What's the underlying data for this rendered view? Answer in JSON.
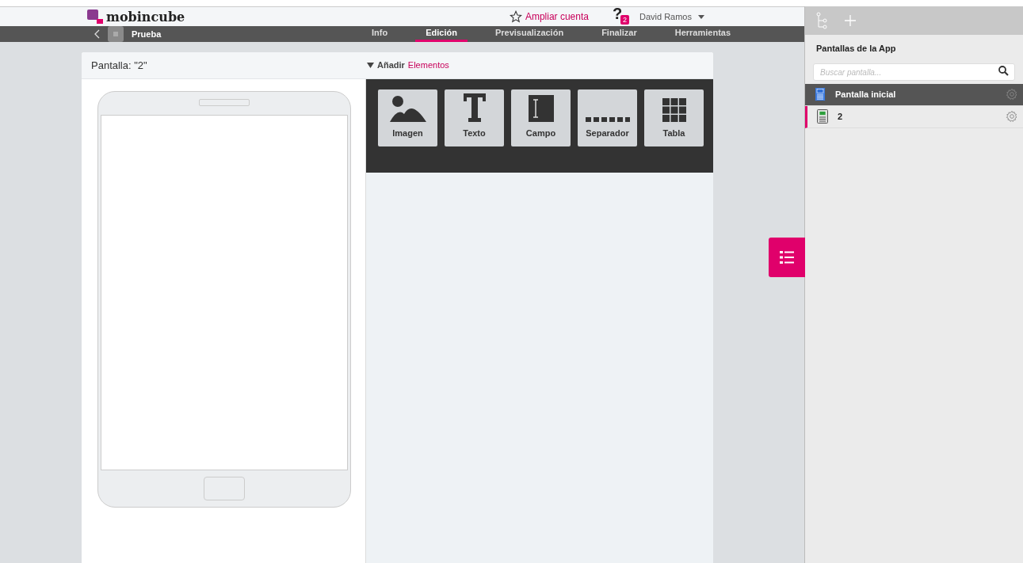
{
  "header": {
    "logo": "mobincube",
    "upgrade_link": "Ampliar cuenta",
    "help_icon": "?",
    "help_badge": "2",
    "user": "David Ramos"
  },
  "nav": {
    "project": "Prueba",
    "tabs": [
      {
        "label": "Info",
        "selected": false
      },
      {
        "label": "Edición",
        "selected": true
      },
      {
        "label": "Previsualización",
        "selected": false
      },
      {
        "label": "Finalizar",
        "selected": false
      },
      {
        "label": "Herramientas",
        "selected": false
      }
    ]
  },
  "editor": {
    "screen_title": "Pantalla: \"2\"",
    "add_toggle": "Añadir",
    "add_link": "Elementos",
    "elements": [
      {
        "kind": "image",
        "label": "Imagen"
      },
      {
        "kind": "text",
        "label": "Texto"
      },
      {
        "kind": "field",
        "label": "Campo"
      },
      {
        "kind": "separator",
        "label": "Separador"
      },
      {
        "kind": "table",
        "label": "Tabla"
      }
    ]
  },
  "sidebar": {
    "title": "Pantallas de la App",
    "search": {
      "placeholder": "Buscar pantalla..."
    },
    "screens": [
      {
        "kind": "home",
        "label": "Pantalla inicial",
        "selected": true
      },
      {
        "kind": "screen",
        "label": "2",
        "selected": false
      }
    ]
  }
}
